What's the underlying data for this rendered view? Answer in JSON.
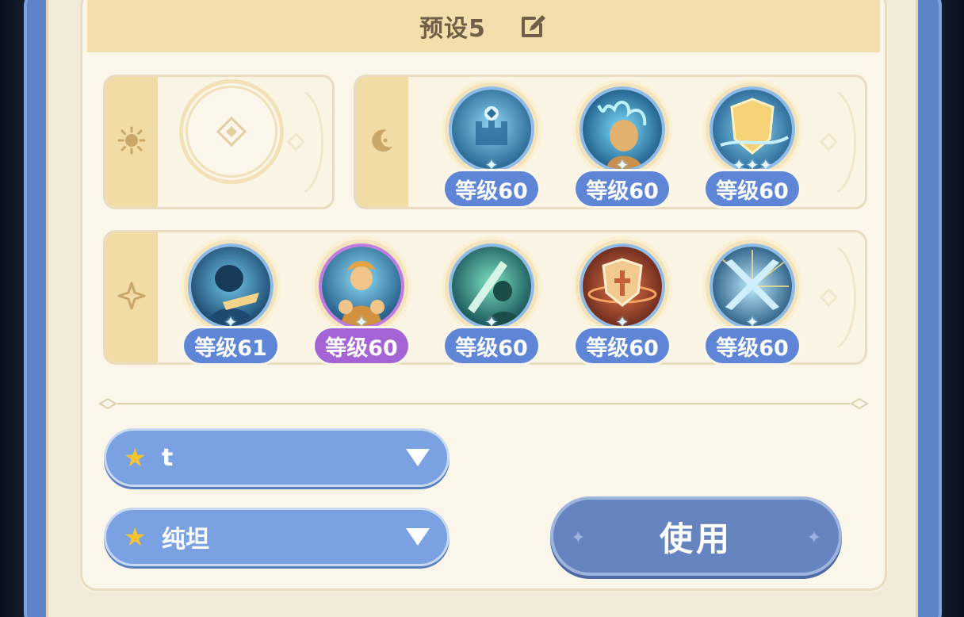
{
  "header": {
    "title": "预设5"
  },
  "rows": [
    {
      "slots": []
    },
    {
      "slots": [
        {
          "level": "等级60",
          "variant": "blue",
          "art": "castle"
        },
        {
          "level": "等级60",
          "variant": "blue",
          "art": "hero-flame"
        },
        {
          "level": "等级60",
          "variant": "blue",
          "art": "shield-wind"
        }
      ]
    },
    {
      "slots": [
        {
          "level": "等级61",
          "variant": "blue",
          "art": "hero-dark"
        },
        {
          "level": "等级60",
          "variant": "purple",
          "art": "hero-gold"
        },
        {
          "level": "等级60",
          "variant": "blue",
          "art": "sword-green"
        },
        {
          "level": "等级60",
          "variant": "blue",
          "art": "shield-fire"
        },
        {
          "level": "等级60",
          "variant": "blue",
          "art": "crossed-swords"
        }
      ]
    }
  ],
  "dropdowns": [
    {
      "label": "t"
    },
    {
      "label": "纯坦"
    }
  ],
  "use_button": {
    "label": "使用"
  },
  "colors": {
    "badge_blue": "#5f86d6",
    "badge_purple": "#a464d6",
    "accent_gold": "#f2dca6",
    "frame_blue": "#5d84c8"
  }
}
